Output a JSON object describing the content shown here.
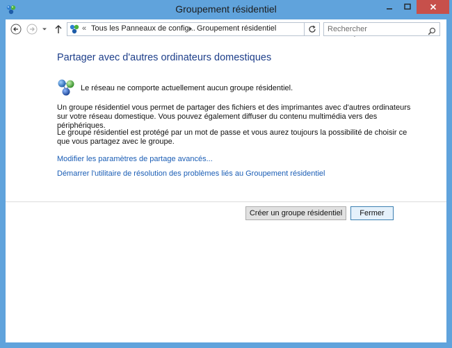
{
  "window": {
    "title": "Groupement résidentiel"
  },
  "navigation": {
    "breadcrumb_prefix": "«",
    "breadcrumb": [
      "Tous les Panneaux de config...",
      "Groupement résidentiel"
    ],
    "search_placeholder": "Rechercher"
  },
  "content": {
    "heading": "Partager avec d'autres ordinateurs domestiques",
    "status": "Le réseau ne comporte actuellement aucun groupe résidentiel.",
    "paragraph1": "Un groupe résidentiel vous permet de partager des fichiers et des imprimantes avec d'autres ordinateurs sur votre réseau domestique. Vous pouvez également diffuser du contenu multimédia vers des périphériques.",
    "paragraph2": "Le groupe résidentiel est protégé par un mot de passe et vous aurez toujours la possibilité de choisir ce que vous partagez avec le groupe.",
    "links": [
      "Modifier les paramètres de partage avancés...",
      "Démarrer l'utilitaire de résolution des problèmes liés au Groupement résidentiel"
    ]
  },
  "buttons": {
    "create": "Créer un groupe résidentiel",
    "close": "Fermer"
  },
  "colors": {
    "frame": "#60a3dc",
    "heading": "#1e3f8a",
    "link": "#1a5db5",
    "close_button": "#c7504b"
  }
}
